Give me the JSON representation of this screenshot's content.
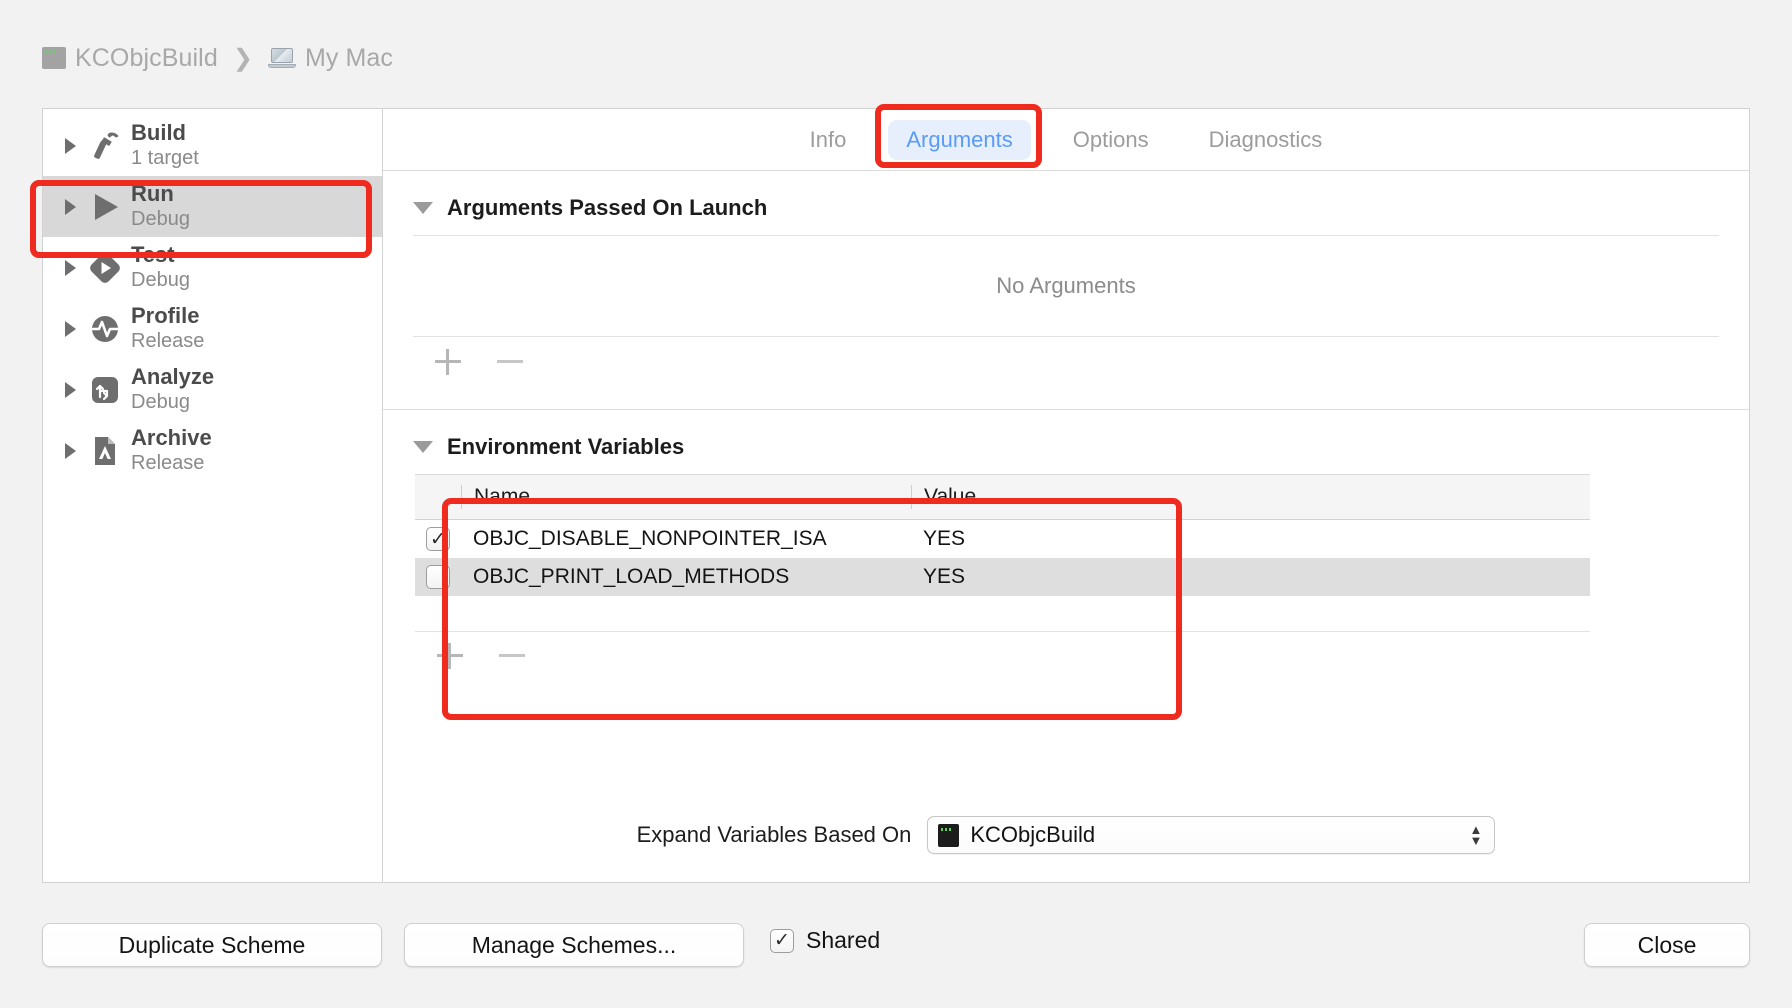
{
  "breadcrumb": {
    "project": "KCObjcBuild",
    "separator": "❯",
    "destination": "My Mac",
    "project_icon": "xcode-project-icon",
    "destination_icon": "macbook-icon"
  },
  "sidebar": {
    "items": [
      {
        "title": "Build",
        "subtitle": "1 target",
        "icon": "hammer-icon",
        "selected": false
      },
      {
        "title": "Run",
        "subtitle": "Debug",
        "icon": "play-icon",
        "selected": true
      },
      {
        "title": "Test",
        "subtitle": "Debug",
        "icon": "test-diamond-icon",
        "selected": false
      },
      {
        "title": "Profile",
        "subtitle": "Release",
        "icon": "pulse-icon",
        "selected": false
      },
      {
        "title": "Analyze",
        "subtitle": "Debug",
        "icon": "analyze-icon",
        "selected": false
      },
      {
        "title": "Archive",
        "subtitle": "Release",
        "icon": "archive-icon",
        "selected": false
      }
    ]
  },
  "tabs": [
    {
      "label": "Info",
      "active": false
    },
    {
      "label": "Arguments",
      "active": true
    },
    {
      "label": "Options",
      "active": false
    },
    {
      "label": "Diagnostics",
      "active": false
    }
  ],
  "arguments_section": {
    "title": "Arguments Passed On Launch",
    "empty_text": "No Arguments",
    "add_label": "+",
    "remove_label": "−"
  },
  "environment_section": {
    "title": "Environment Variables",
    "columns": [
      "Name",
      "Value"
    ],
    "rows": [
      {
        "checked": true,
        "name": "OBJC_DISABLE_NONPOINTER_ISA",
        "value": "YES"
      },
      {
        "checked": false,
        "name": "OBJC_PRINT_LOAD_METHODS",
        "value": "YES"
      }
    ],
    "add_label": "+",
    "remove_label": "−"
  },
  "expand_variables": {
    "label": "Expand Variables Based On",
    "selected": "KCObjcBuild",
    "icon": "xcode-project-icon"
  },
  "bottom_bar": {
    "duplicate_scheme": "Duplicate Scheme",
    "manage_schemes": "Manage Schemes...",
    "shared_label": "Shared",
    "shared_checked": true,
    "close": "Close"
  },
  "annotations": {
    "highlight_color": "#EF2B20",
    "boxes": [
      "run-scheme-row",
      "arguments-tab",
      "environment-variables-table"
    ]
  },
  "colors": {
    "accent_blue": "#5A9BF6",
    "tab_active_bg": "#E7EFFD",
    "selection_gray": "#D8D8D8",
    "window_bg": "#F2F2F2"
  }
}
